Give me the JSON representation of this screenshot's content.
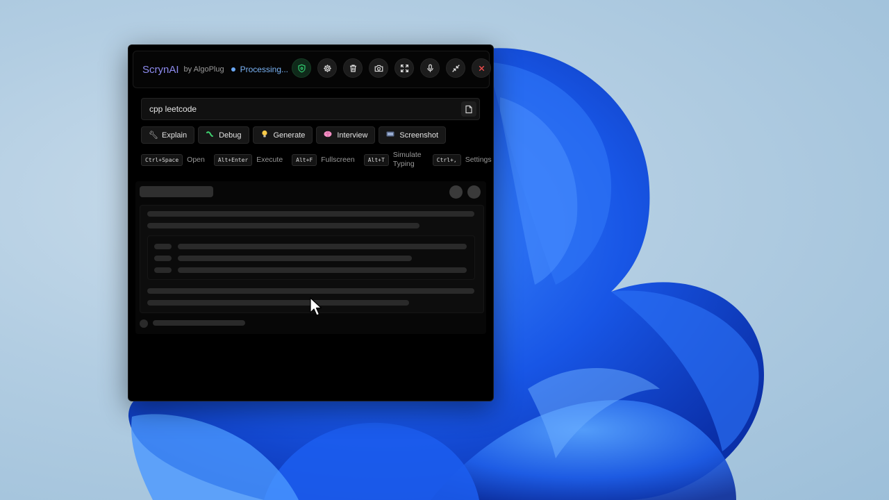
{
  "app": {
    "name": "ScrynAI",
    "byline": "by AlgoPlug",
    "status": "Processing..."
  },
  "header_icons": [
    "shield-icon",
    "gear-icon",
    "trash-icon",
    "camera-icon",
    "fullscreen-icon",
    "microphone-icon",
    "minimize-icon",
    "close-icon"
  ],
  "prompt": {
    "value": "cpp leetcode",
    "placeholder": ""
  },
  "actions": [
    {
      "label": "Explain",
      "icon": "wrench-icon"
    },
    {
      "label": "Debug",
      "icon": "bug-icon"
    },
    {
      "label": "Generate",
      "icon": "lightbulb-icon"
    },
    {
      "label": "Interview",
      "icon": "brain-icon"
    },
    {
      "label": "Screenshot",
      "icon": "screenshot-icon"
    }
  ],
  "shortcuts": [
    {
      "key": "Ctrl+Space",
      "desc": "Open"
    },
    {
      "key": "Alt+Enter",
      "desc": "Execute"
    },
    {
      "key": "Alt+F",
      "desc": "Fullscreen"
    },
    {
      "key": "Alt+T",
      "desc": "Simulate Typing"
    },
    {
      "key": "Ctrl+,",
      "desc": "Settings"
    }
  ],
  "colors": {
    "brand": "#8e8cf0",
    "status": "#7ab3f5",
    "shield": "#2fc26b",
    "close": "#ea4a4a"
  }
}
